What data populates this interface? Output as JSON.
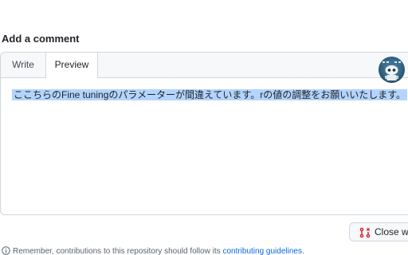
{
  "comment": {
    "heading": "Add a comment",
    "tabs": [
      {
        "label": "Write",
        "active": false
      },
      {
        "label": "Preview",
        "active": true
      }
    ],
    "preview_text": "ここちらのFine tuningのパラメーターが間違えています。rの値の調整をお願いいたします。"
  },
  "actions": {
    "close_label": "Close w"
  },
  "notice": {
    "prefix": "Remember, contributions to this repository should follow its ",
    "link": "contributing guidelines",
    "suffix": "."
  },
  "colors": {
    "selection": "#b3d4fc",
    "link": "#0969da",
    "close_icon": "#cf222e",
    "border": "#d0d7de"
  }
}
